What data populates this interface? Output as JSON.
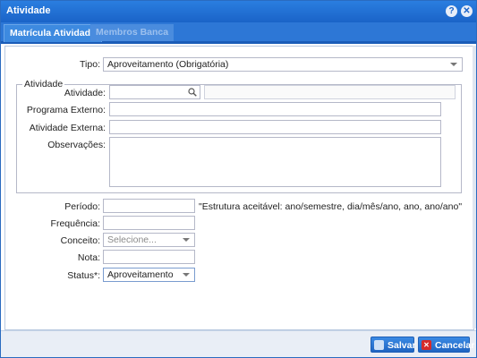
{
  "window": {
    "title": "Atividade"
  },
  "tabs": [
    {
      "label": "Matrícula Atividade",
      "active": true
    },
    {
      "label": "Membros Banca",
      "active": false
    }
  ],
  "form": {
    "tipo_label": "Tipo:",
    "tipo_value": "Aproveitamento (Obrigatória)",
    "fieldset_legend": "Atividade",
    "atividade_label": "Atividade:",
    "programa_externo_label": "Programa Externo:",
    "atividade_externa_label": "Atividade Externa:",
    "observacoes_label": "Observações:",
    "periodo_label": "Período:",
    "periodo_hint": "\"Estrutura aceitável: ano/semestre, dia/mês/ano, ano, ano/ano\"",
    "frequencia_label": "Frequência:",
    "conceito_label": "Conceito:",
    "conceito_placeholder": "Selecione...",
    "nota_label": "Nota:",
    "status_label": "Status*:",
    "status_value": "Aproveitamento"
  },
  "footer": {
    "save_label": "Salvar",
    "cancel_label": "Cancelar"
  },
  "colors": {
    "titlebar": "#1a63c8",
    "accent": "#2d77d6",
    "cancel": "#d62a2a"
  },
  "icons": {
    "help": "help-icon",
    "close": "close-icon",
    "search": "search-icon",
    "save": "save-icon",
    "cancel": "cancel-icon"
  }
}
